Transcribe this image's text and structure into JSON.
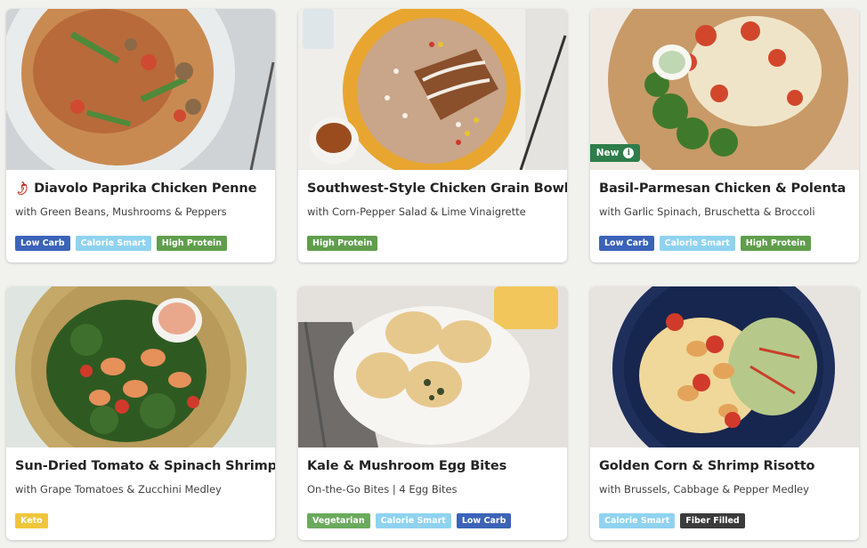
{
  "meals": [
    {
      "title": "Diavolo Paprika Chicken Penne",
      "subtitle": "with Green Beans, Mushrooms & Peppers",
      "spicy_icon": "chili-pepper-icon",
      "badge": null,
      "tags": [
        "Low Carb",
        "Calorie Smart",
        "High Protein"
      ]
    },
    {
      "title": "Southwest-Style Chicken Grain Bowl",
      "subtitle": "with Corn-Pepper Salad & Lime Vinaigrette",
      "badge": null,
      "tags": [
        "High Protein"
      ]
    },
    {
      "title": "Basil-Parmesan Chicken & Polenta",
      "subtitle": "with Garlic Spinach, Bruschetta & Broccoli",
      "badge": "New",
      "badge_icon": "info-icon",
      "tags": [
        "Low Carb",
        "Calorie Smart",
        "High Protein"
      ]
    },
    {
      "title": "Sun-Dried Tomato & Spinach Shrimp",
      "subtitle": "with Grape Tomatoes & Zucchini Medley",
      "badge": null,
      "tags": [
        "Keto"
      ]
    },
    {
      "title": "Kale & Mushroom Egg Bites",
      "subtitle": "On-the-Go Bites | 4 Egg Bites",
      "badge": null,
      "tags": [
        "Vegetarian",
        "Calorie Smart",
        "Low Carb"
      ]
    },
    {
      "title": "Golden Corn & Shrimp Risotto",
      "subtitle": "with Brussels, Cabbage & Pepper Medley",
      "badge": null,
      "tags": [
        "Calorie Smart",
        "Fiber Filled"
      ]
    }
  ],
  "tag_colors": {
    "Low Carb": "#3b63b8",
    "Calorie Smart": "#8fd3f0",
    "High Protein": "#5f9e4c",
    "Keto": "#f0c53a",
    "Vegetarian": "#6aaa5c",
    "Fiber Filled": "#3b3b3b"
  }
}
